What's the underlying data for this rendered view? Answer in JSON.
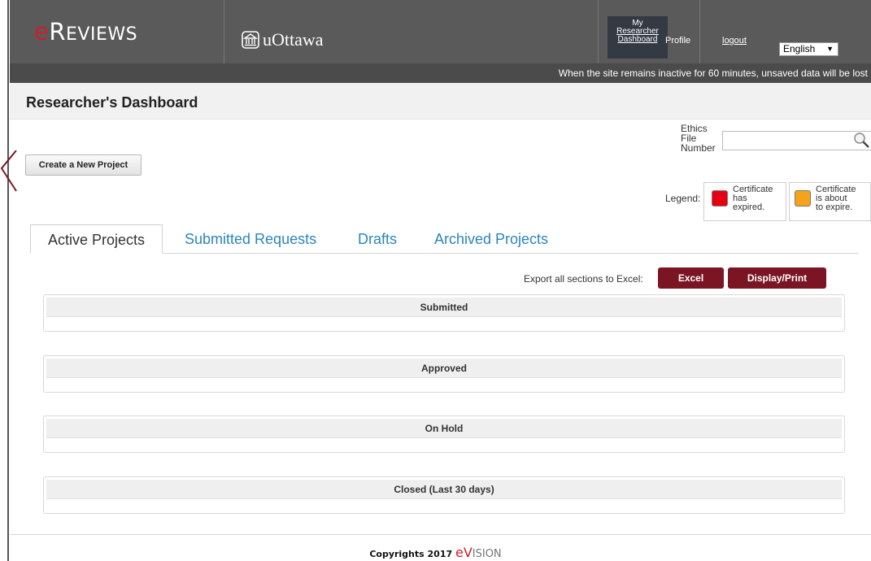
{
  "header": {
    "brand_e": "e",
    "brand_r": "R",
    "brand_rest": "EVIEWS",
    "institution": "uOttawa",
    "nav": {
      "dashboard_line1": "My",
      "dashboard_line2": "Researcher",
      "dashboard_line3": "Dashboard",
      "profile": "Profile",
      "logout": "logout"
    },
    "language_selected": "English",
    "inactivity_notice": "When the site remains inactive for 60 minutes, unsaved data will be lost"
  },
  "page": {
    "title": "Researcher's Dashboard"
  },
  "actions": {
    "create_project": "Create a New Project"
  },
  "search": {
    "ethics_label_1": "Ethics",
    "ethics_label_2": "File",
    "ethics_label_3": "Number",
    "value": ""
  },
  "legend": {
    "label": "Legend:",
    "items": [
      {
        "color": "#e60012",
        "line1": "Certificate",
        "line2": "has",
        "line3": "expired."
      },
      {
        "color": "#f7a21b",
        "line1": "Certificate",
        "line2": "is about",
        "line3": "to expire."
      }
    ]
  },
  "tabs": [
    {
      "label": "Active Projects",
      "active": true
    },
    {
      "label": "Submitted Requests",
      "active": false
    },
    {
      "label": "Drafts",
      "active": false
    },
    {
      "label": "Archived Projects",
      "active": false
    }
  ],
  "export": {
    "label": "Export all sections to Excel:",
    "excel": "Excel",
    "display_print": "Display/Print"
  },
  "sections": [
    {
      "title": "Submitted"
    },
    {
      "title": "Approved"
    },
    {
      "title": "On Hold"
    },
    {
      "title": "Closed (Last 30 days)"
    }
  ],
  "footer": {
    "copyright": "Copyrights 2017",
    "brand_e": "e",
    "brand_v": "V",
    "brand_rest": "ISION"
  },
  "colors": {
    "header_bg": "#5a5a5a",
    "accent_red": "#c8202c",
    "maroon_button": "#7b1523",
    "tab_link": "#2a86b8"
  }
}
